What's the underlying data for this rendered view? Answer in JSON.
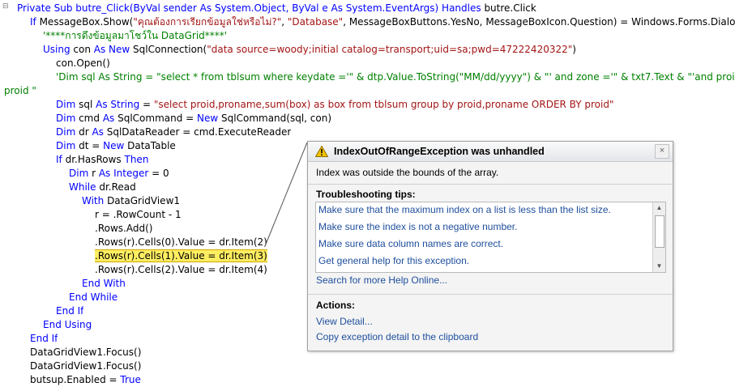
{
  "code_lines": [
    [
      {
        "t": "Private Sub butre_Click(ByVal sender As System.Object, ByVal e As System.EventArgs) ",
        "c": "kw"
      },
      {
        "t": "Handles",
        "c": "kw"
      },
      {
        "t": " butre.Click",
        "c": ""
      }
    ],
    [
      {
        "t": "If",
        "c": "kw"
      },
      {
        "t": " MessageBox.Show(",
        "c": ""
      },
      {
        "t": "\"คุณต้องการเรียกข้อมูลใช่หรือไม่?\"",
        "c": "str"
      },
      {
        "t": ", ",
        "c": ""
      },
      {
        "t": "\"Database\"",
        "c": "str"
      },
      {
        "t": ", MessageBoxButtons.YesNo, MessageBoxIcon.Question) = Windows.Forms.DialogRes",
        "c": ""
      }
    ],
    [
      {
        "t": "'****การดึงข้อมูลมาโชว์ใน DataGrid****'",
        "c": "cm"
      }
    ],
    [
      {
        "t": "Using",
        "c": "kw"
      },
      {
        "t": " con ",
        "c": ""
      },
      {
        "t": "As New",
        "c": "kw"
      },
      {
        "t": " SqlConnection(",
        "c": ""
      },
      {
        "t": "\"data source=woody;initial catalog=transport;uid=sa;pwd=47222420322\"",
        "c": "str"
      },
      {
        "t": ")",
        "c": ""
      }
    ],
    [
      {
        "t": "con.Open()",
        "c": ""
      }
    ],
    [
      {
        "t": "'Dim sql As String = \"select * from tblsum where keydate ='\" & dtp.Value.ToString(\"MM/dd/yyyy\") & \"' and zone ='\" & txt7.Text & \"'and proid not i",
        "c": "cm"
      }
    ],
    [
      {
        "t": "proid \"",
        "c": "cm"
      }
    ],
    [
      {
        "t": "Dim",
        "c": "kw"
      },
      {
        "t": " sql ",
        "c": ""
      },
      {
        "t": "As String",
        "c": "kw"
      },
      {
        "t": " = ",
        "c": ""
      },
      {
        "t": "\"select proid,proname,sum(box) as box from tblsum group by proid,proname ORDER BY proid\"",
        "c": "str"
      }
    ],
    [
      {
        "t": "Dim",
        "c": "kw"
      },
      {
        "t": " cmd ",
        "c": ""
      },
      {
        "t": "As",
        "c": "kw"
      },
      {
        "t": " SqlCommand = ",
        "c": ""
      },
      {
        "t": "New",
        "c": "kw"
      },
      {
        "t": " SqlCommand(sql, con)",
        "c": ""
      }
    ],
    [
      {
        "t": "Dim",
        "c": "kw"
      },
      {
        "t": " dr ",
        "c": ""
      },
      {
        "t": "As",
        "c": "kw"
      },
      {
        "t": " SqlDataReader = cmd.ExecuteReader",
        "c": ""
      }
    ],
    [
      {
        "t": "Dim",
        "c": "kw"
      },
      {
        "t": " dt = ",
        "c": ""
      },
      {
        "t": "New",
        "c": "kw"
      },
      {
        "t": " DataTable",
        "c": ""
      }
    ],
    [
      {
        "t": "If",
        "c": "kw"
      },
      {
        "t": " dr.HasRows ",
        "c": ""
      },
      {
        "t": "Then",
        "c": "kw"
      }
    ],
    [
      {
        "t": "Dim",
        "c": "kw"
      },
      {
        "t": " r ",
        "c": ""
      },
      {
        "t": "As Integer",
        "c": "kw"
      },
      {
        "t": " = 0",
        "c": ""
      }
    ],
    [
      {
        "t": "While",
        "c": "kw"
      },
      {
        "t": " dr.Read",
        "c": ""
      }
    ],
    [
      {
        "t": "With",
        "c": "kw"
      },
      {
        "t": " DataGridView1",
        "c": ""
      }
    ],
    [
      {
        "t": "r = .RowCount - 1",
        "c": ""
      }
    ],
    [
      {
        "t": ".Rows.Add()",
        "c": ""
      }
    ],
    [
      {
        "t": ".Rows(r).Cells(0).Value = dr.Item(2)",
        "c": ""
      }
    ],
    [
      {
        "t": ".Rows(r).Cells(1).Value = dr.Item(3)",
        "c": "hl"
      }
    ],
    [
      {
        "t": ".Rows(r).Cells(2).Value = dr.Item(4)",
        "c": ""
      }
    ],
    [
      {
        "t": "End With",
        "c": "kw"
      }
    ],
    [
      {
        "t": "End While",
        "c": "kw"
      }
    ],
    [
      {
        "t": "End If",
        "c": "kw"
      }
    ],
    [
      {
        "t": "End Using",
        "c": "kw"
      }
    ],
    [
      {
        "t": "End If",
        "c": "kw"
      }
    ],
    [
      {
        "t": "DataGridView1.Focus()",
        "c": ""
      }
    ],
    [
      {
        "t": "DataGridView1.Focus()",
        "c": ""
      }
    ],
    [
      {
        "t": "butsup.Enabled = ",
        "c": ""
      },
      {
        "t": "True",
        "c": "kw"
      }
    ]
  ],
  "exception": {
    "title": "IndexOutOfRangeException was unhandled",
    "message": "Index was outside the bounds of the array.",
    "tips_heading": "Troubleshooting tips:",
    "tips": [
      "Make sure that the maximum index on a list is less than the list size.",
      "Make sure the index is not a negative number.",
      "Make sure data column names are correct.",
      "Get general help for this exception."
    ],
    "search_link": "Search for more Help Online...",
    "actions_heading": "Actions:",
    "actions": [
      "View Detail...",
      "Copy exception detail to the clipboard"
    ],
    "close_label": "×"
  },
  "icons": {
    "warning": "warning-icon",
    "close": "close-icon"
  },
  "colors": {
    "keyword": "#0000ff",
    "string": "#a31515",
    "comment": "#008000",
    "highlight": "#ffee62",
    "link": "#1e4e9c"
  }
}
